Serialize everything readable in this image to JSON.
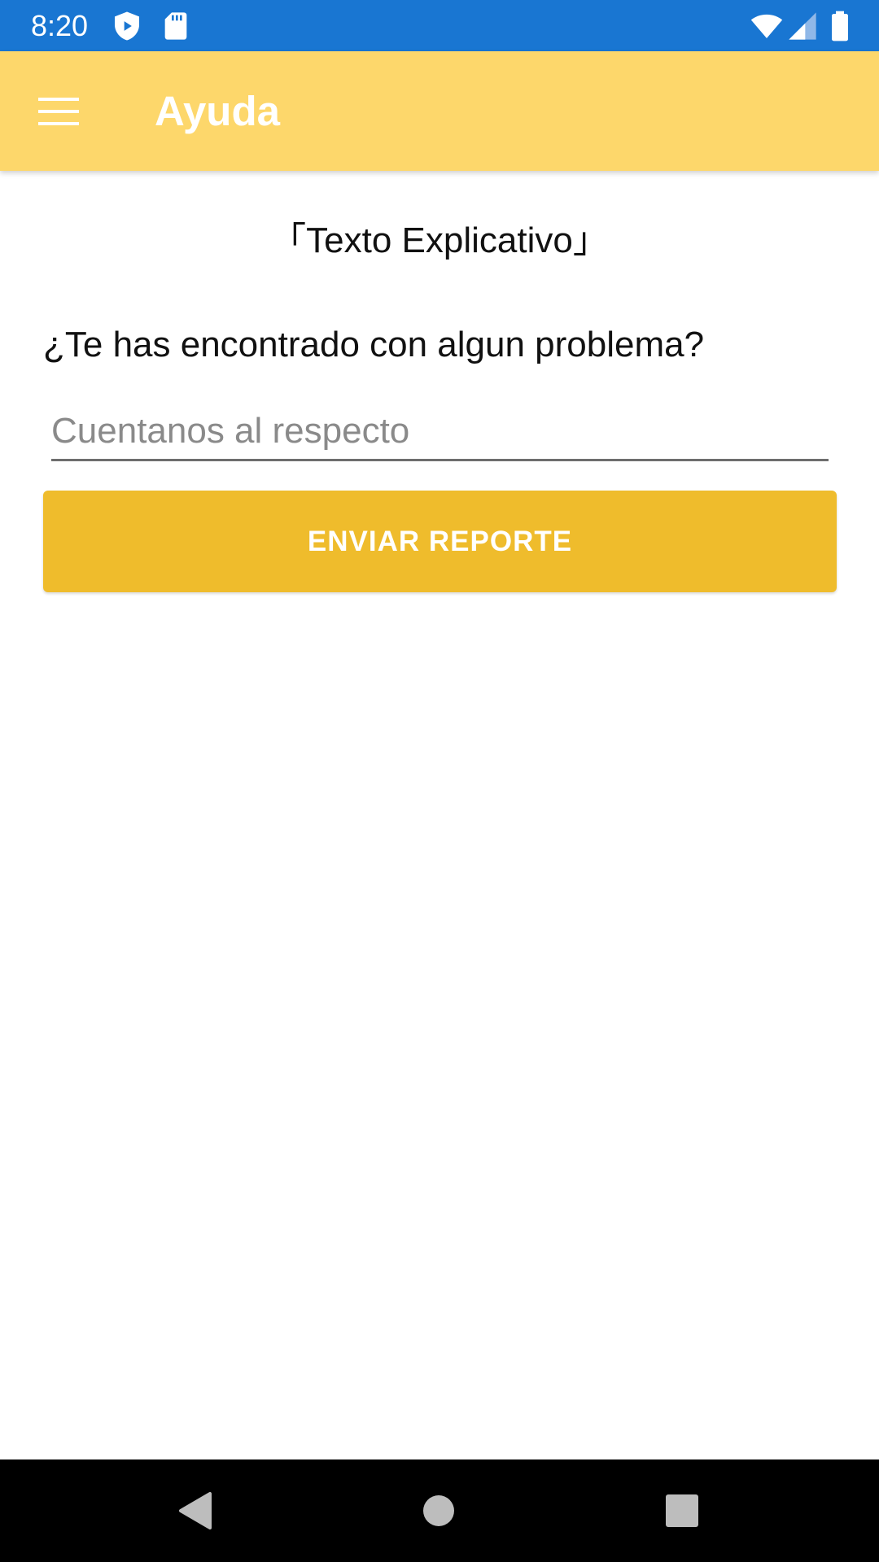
{
  "status_bar": {
    "time": "8:20",
    "icons": [
      "shield-play-icon",
      "sd-card-icon",
      "wifi-icon",
      "cell-signal-icon",
      "battery-icon"
    ],
    "color": "#1976d2"
  },
  "app_bar": {
    "title": "Ayuda",
    "menu_icon": "hamburger-menu-icon",
    "color": "#fdd76b"
  },
  "main": {
    "explain_text": "「Texto Explicativo」",
    "question": "¿Te has encontrado con algun problema?",
    "report_input": {
      "value": "",
      "placeholder": "Cuentanos al respecto"
    },
    "send_button": {
      "label": "ENVIAR REPORTE",
      "color": "#efbc2c"
    }
  },
  "nav_bar": {
    "icons": [
      "back-icon",
      "home-icon",
      "recents-icon"
    ]
  }
}
